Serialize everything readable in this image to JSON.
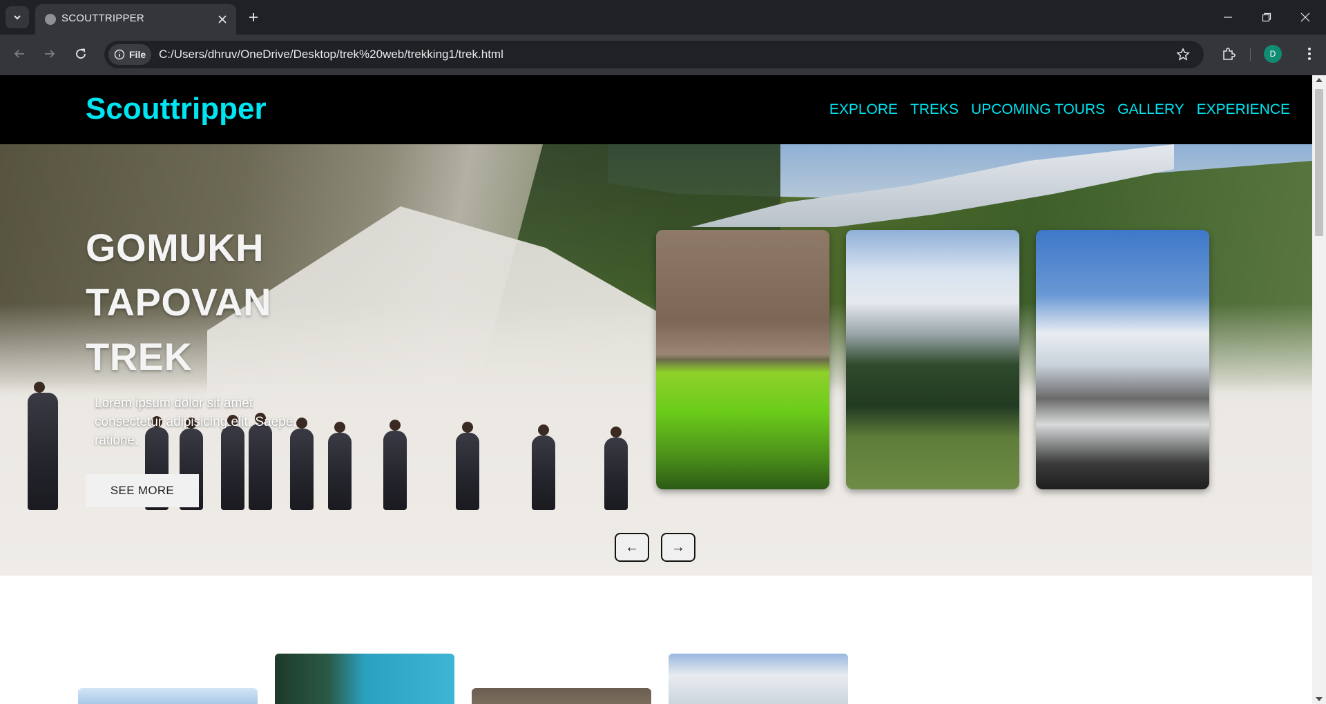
{
  "browser": {
    "tab_title": "SCOUTTRIPPER",
    "site_chip": "File",
    "url": "C:/Users/dhruv/OneDrive/Desktop/trek%20web/trekking1/trek.html",
    "profile_initial": "D"
  },
  "site": {
    "brand": "Scouttripper",
    "nav": [
      "EXPLORE",
      "TREKS",
      "UPCOMING TOURS",
      "GALLERY",
      "EXPERIENCE"
    ]
  },
  "hero": {
    "title_lines": [
      "GOMUKH",
      "TAPOVAN",
      "TREK"
    ],
    "description": "Lorem ipsum dolor sit amet consectetur adipisicing elit. Saepe, ratione.",
    "cta_label": "SEE MORE",
    "prev_label": "←",
    "next_label": "→"
  }
}
